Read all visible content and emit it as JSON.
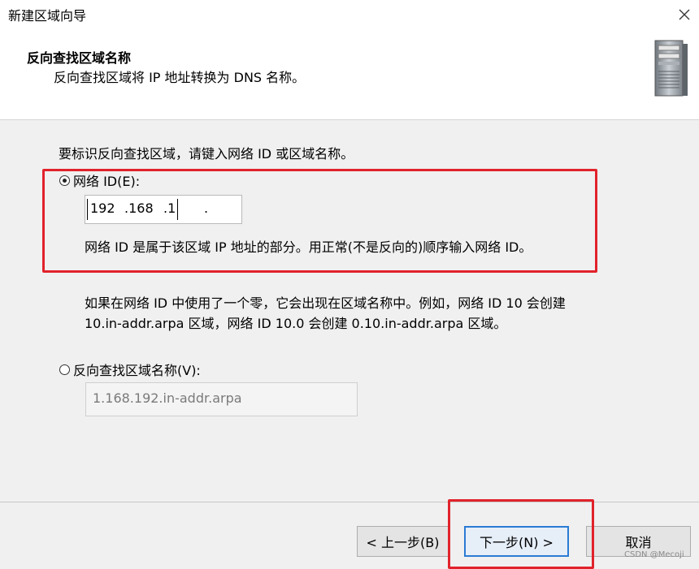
{
  "window": {
    "title": "新建区域向导"
  },
  "header": {
    "title": "反向查找区域名称",
    "subtitle": "反向查找区域将 IP 地址转换为 DNS 名称。",
    "icon": "server-icon"
  },
  "content": {
    "intro": "要标识反向查找区域，请键入网络 ID 或区域名称。",
    "network_id_option": {
      "label": "网络 ID(E):",
      "selected": true
    },
    "ip_octets": [
      "192",
      ".168",
      ".1",
      "."
    ],
    "network_id_help": "网络 ID 是属于该区域 IP 地址的部分。用正常(不是反向的)顺序输入网络 ID。",
    "zero_note_line1": "如果在网络 ID 中使用了一个零，它会出现在区域名称中。例如，网络 ID 10 会创建",
    "zero_note_line2": "10.in-addr.arpa 区域，网络 ID 10.0 会创建 0.10.in-addr.arpa 区域。",
    "zone_name_option": {
      "label": "反向查找区域名称(V):",
      "selected": false
    },
    "zone_name_value": "1.168.192.in-addr.arpa"
  },
  "footer": {
    "back_label": "< 上一步(B)",
    "next_label": "下一步(N) >",
    "cancel_label": "取消"
  },
  "watermark": "CSDN @Mecoji",
  "colors": {
    "highlight_red": "#e1222b",
    "focus_blue": "#2a7bd4"
  }
}
